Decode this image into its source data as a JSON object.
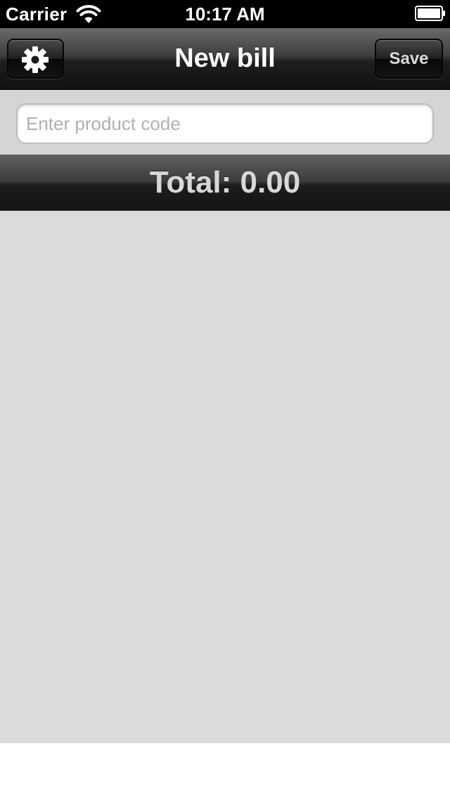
{
  "status_bar": {
    "carrier": "Carrier",
    "time": "10:17 AM",
    "wifi_icon": "wifi-icon",
    "battery_icon": "battery-icon"
  },
  "navbar": {
    "title": "New bill",
    "settings_icon": "gear-icon",
    "save_label": "Save"
  },
  "product_code": {
    "placeholder": "Enter product code",
    "value": ""
  },
  "total": {
    "text": "Total: 0.00"
  },
  "colors": {
    "navbar_dark": "#111111",
    "content_background": "#dbdbdb",
    "search_background": "#d5d5d5",
    "total_text": "#d8d8d8"
  }
}
